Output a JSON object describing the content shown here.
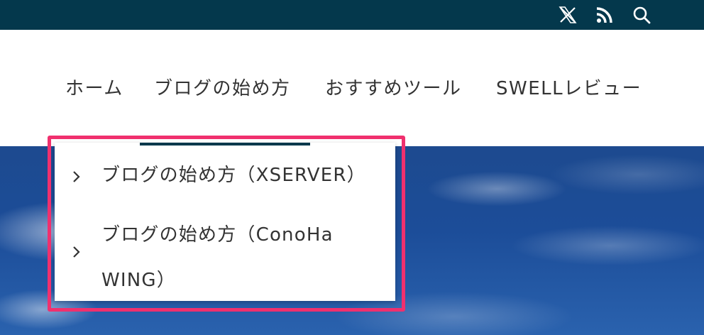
{
  "topbar": {
    "icons": [
      "x-logo-icon",
      "rss-icon",
      "search-icon"
    ]
  },
  "nav": {
    "items": [
      {
        "label": "ホーム"
      },
      {
        "label": "ブログの始め方"
      },
      {
        "label": "おすすめツール"
      },
      {
        "label": "SWELLレビュー"
      }
    ]
  },
  "dropdown": {
    "items": [
      {
        "label": "ブログの始め方（XSERVER）"
      },
      {
        "label": "ブログの始め方（ConoHa WING）"
      }
    ]
  },
  "colors": {
    "topbar": "#04384c",
    "highlight_border": "#f0306e",
    "text": "#333333",
    "hero": "#1d4a8f"
  }
}
